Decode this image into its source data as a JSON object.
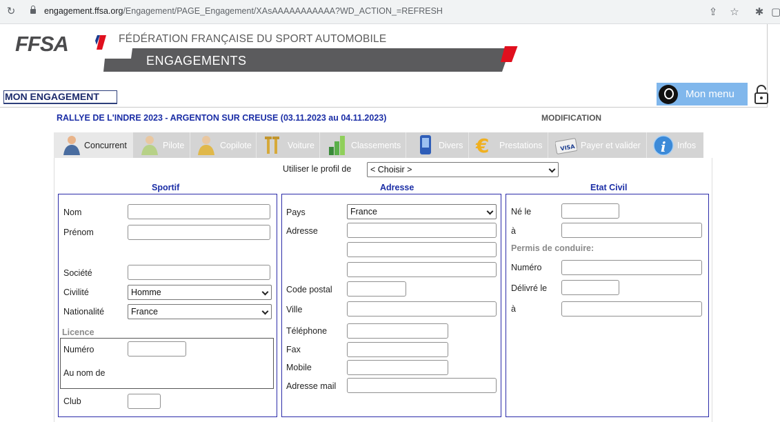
{
  "browser": {
    "url_host": "engagement.ffsa.org",
    "url_path": "/Engagement/PAGE_Engagement/XAsAAAAAAAAAAA?WD_ACTION_=REFRESH"
  },
  "header": {
    "logo": "FFSA",
    "federation": "FÉDÉRATION FRANÇAISE DU SPORT AUTOMOBILE",
    "section": "ENGAGEMENTS",
    "page_label": "MON ENGAGEMENT",
    "menu_label": "Mon menu"
  },
  "event": {
    "title": "RALLYE DE L'INDRE 2023 - ARGENTON SUR CREUSE (03.11.2023 au 04.11.2023)",
    "mode": "MODIFICATION"
  },
  "tabs": [
    {
      "label": "Concurrent",
      "icon": "person-icon",
      "active": true
    },
    {
      "label": "Pilote",
      "icon": "person-icon",
      "active": false
    },
    {
      "label": "Copilote",
      "icon": "person-icon",
      "active": false
    },
    {
      "label": "Voiture",
      "icon": "tools-icon",
      "active": false
    },
    {
      "label": "Classements",
      "icon": "chart-icon",
      "active": false
    },
    {
      "label": "Divers",
      "icon": "phone-icon",
      "active": false
    },
    {
      "label": "Prestations",
      "icon": "euro-icon",
      "active": false
    },
    {
      "label": "Payer et valider",
      "icon": "visa-card-icon",
      "active": false
    },
    {
      "label": "Infos",
      "icon": "info-icon",
      "active": false
    }
  ],
  "profile": {
    "label": "Utiliser le profil de",
    "selected": "< Choisir >"
  },
  "sportif": {
    "title": "Sportif",
    "nom": "Nom",
    "prenom": "Prénom",
    "societe": "Société",
    "civilite": "Civilité",
    "civilite_value": "Homme",
    "nationalite": "Nationalité",
    "nationalite_value": "France",
    "licence": "Licence",
    "numero": "Numéro",
    "au_nom_de": "Au nom de",
    "club": "Club"
  },
  "adresse": {
    "title": "Adresse",
    "pays": "Pays",
    "pays_value": "France",
    "adresse": "Adresse",
    "code_postal": "Code postal",
    "ville": "Ville",
    "telephone": "Téléphone",
    "fax": "Fax",
    "mobile": "Mobile",
    "adresse_mail": "Adresse mail"
  },
  "etat_civil": {
    "title": "Etat Civil",
    "ne_le": "Né le",
    "a": "à",
    "permis": "Permis de conduire:",
    "numero": "Numéro",
    "delivre_le": "Délivré le",
    "a2": "à"
  },
  "colors": {
    "accent_blue": "#1b2ea6",
    "panel_border": "#2a2aa8",
    "menu_blue": "#80b7ec",
    "ffsa_red": "#e0101e"
  }
}
